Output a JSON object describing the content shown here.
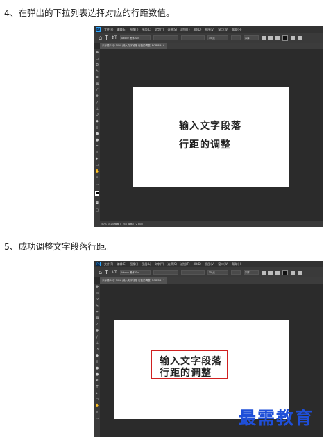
{
  "steps": [
    {
      "text": "4、在弹出的下拉列表选择对应的行距数值。"
    },
    {
      "text": "5、成功调整文字段落行距。"
    }
  ],
  "photoshop": {
    "logo": "Ps",
    "menu": [
      "文件(F)",
      "编辑(E)",
      "图像(I)",
      "图层(L)",
      "文字(Y)",
      "选择(S)",
      "滤镜(T)",
      "3D(D)",
      "视图(V)",
      "窗口(W)",
      "帮助(H)"
    ],
    "options": {
      "font": "Adobe 黑体 Std",
      "size": "",
      "leading": "35 点",
      "tracking": "",
      "aa": "浑厚"
    },
    "doc_tab": "未标题-1 @ 50% (输入文字段落 行距的调整, RGB/8#) *",
    "status": "50%    1024 像素 x 768 像素 (72 ppi)",
    "tool_icons": [
      "move-icon",
      "marquee-icon",
      "lasso-icon",
      "quick-select-icon",
      "crop-icon",
      "frame-icon",
      "eyedropper-icon",
      "healing-icon",
      "brush-icon",
      "stamp-icon",
      "history-brush-icon",
      "eraser-icon",
      "gradient-icon",
      "blur-icon",
      "dodge-icon",
      "pen-icon",
      "type-icon",
      "path-select-icon",
      "rectangle-icon",
      "hand-icon",
      "zoom-icon",
      "more-icon"
    ]
  },
  "canvas_text": {
    "shot1_line1": "输入文字段落",
    "shot1_line2": "行距的调整",
    "shot2_line1": "输入文字段落",
    "shot2_line2": "行距的调整"
  },
  "watermark": "最需教育",
  "colors": {
    "workspace": "#2b2b2b",
    "panel": "#3a3a3a",
    "selection_box": "#d02020",
    "watermark": "#1f4fd8",
    "ps_blue": "#31a8ff"
  }
}
